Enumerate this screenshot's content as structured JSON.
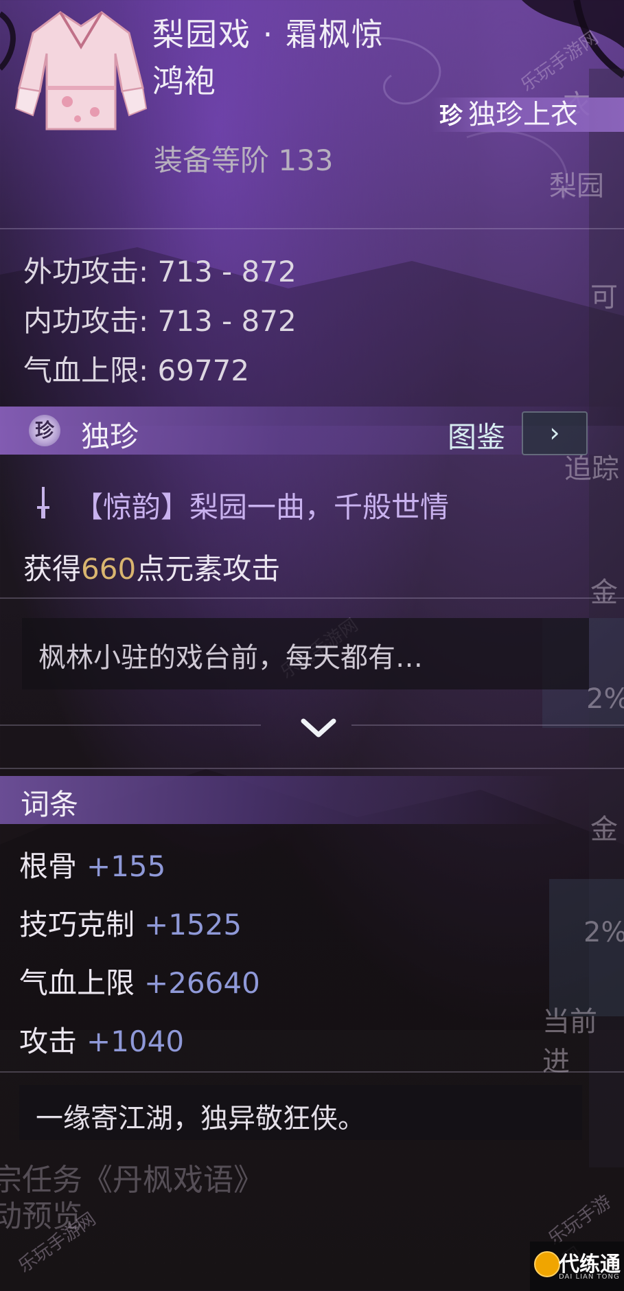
{
  "item": {
    "title": "梨园戏 · 霜枫惊",
    "subtitle": "鸿袍",
    "quality_tag": "独珍上衣",
    "quality_gem": "珍",
    "rank_label": "装备等阶 133"
  },
  "stats": [
    "外功攻击: 713 - 872",
    "内功攻击: 713 - 872",
    "气血上限: 69772"
  ],
  "unique_section": {
    "title": "独珍",
    "gem": "珍",
    "codex_label": "图鉴",
    "codex_arrow": "›",
    "skill_text": "【惊韵】梨园一曲，千般世情",
    "gain_prefix": "获得",
    "gain_value": "660",
    "gain_suffix": "点元素攻击",
    "description": "枫林小驻的戏台前，每天都有…"
  },
  "entries": {
    "title": "词条",
    "items": [
      {
        "name": "根骨",
        "value": "+155"
      },
      {
        "name": "技巧克制",
        "value": "+1525"
      },
      {
        "name": "气血上限",
        "value": "+26640"
      },
      {
        "name": "攻击",
        "value": "+1040"
      }
    ]
  },
  "quote": "一缘寄江湖，独异敬狂侠。",
  "background_text": {
    "line1": "宗任务《丹枫戏语》",
    "line2": "动预览",
    "right_1": "追踪",
    "right_2": "当前进",
    "right_3": "2%",
    "right_4": "2%",
    "right_5": "可",
    "right_6": "金",
    "right_7": "金",
    "right_8": "梨园",
    "right_9": "衣"
  },
  "watermark": "乐玩手游网",
  "logo": {
    "name": "代练通",
    "sub": "DAI LIAN TONG"
  },
  "colors": {
    "accent_purple": "#8f5fc0",
    "value_gold": "#d9b56f",
    "entry_value": "#8f99d8",
    "skill_text": "#c9b2ef"
  }
}
